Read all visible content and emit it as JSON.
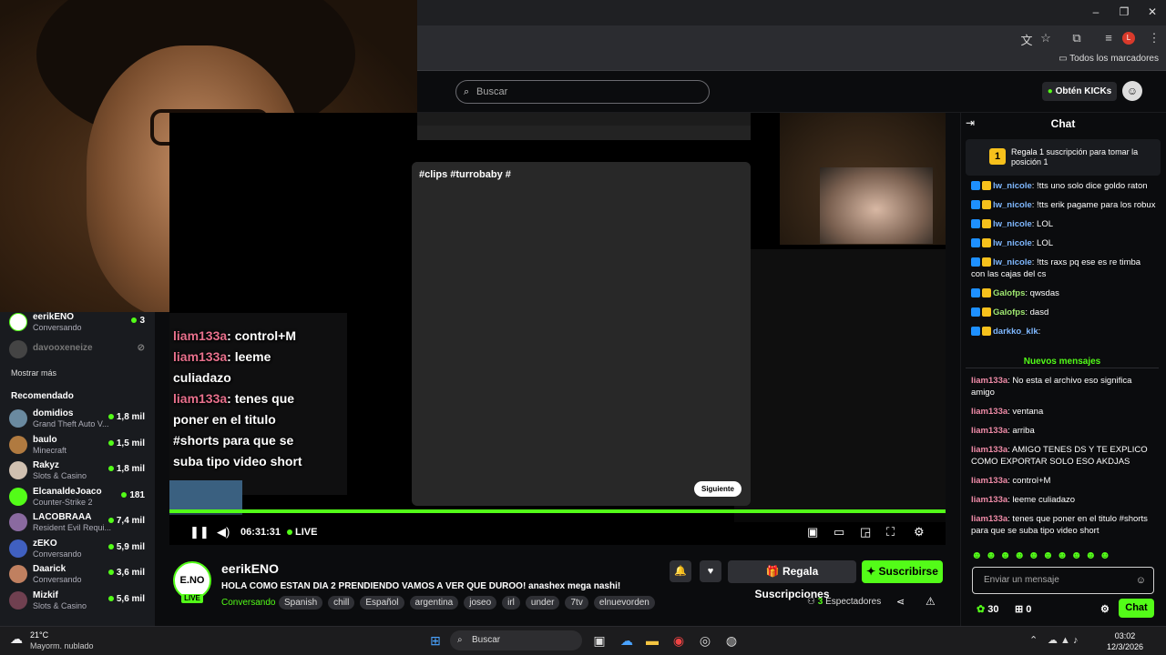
{
  "browser": {
    "bookmarks_label": "Todos los marcadores",
    "window_controls": [
      "minimize-icon",
      "maximize-icon",
      "close-icon"
    ],
    "toolbar_icons": [
      "translate-icon",
      "star-icon",
      "extensions-icon",
      "media-icon",
      "profile-icon",
      "menu-icon"
    ],
    "profile_initial": "L"
  },
  "kick_nav": {
    "search_placeholder": "Buscar",
    "get_kicks": "Obtén KICKs"
  },
  "sidebar": {
    "current": {
      "name": "eerikENO",
      "sub": "Conversando",
      "viewers": "3"
    },
    "offline": {
      "name": "davooxeneize"
    },
    "show_more": "Mostrar más",
    "recommended_title": "Recomendado",
    "recommended": [
      {
        "name": "domidios",
        "sub": "Grand Theft Auto V...",
        "viewers": "1,8 mil",
        "color": "#6a8aa0"
      },
      {
        "name": "baulo",
        "sub": "Minecraft",
        "viewers": "1,5 mil",
        "color": "#b07a40"
      },
      {
        "name": "Rakyz",
        "sub": "Slots & Casino",
        "viewers": "1,8 mil",
        "color": "#d0c0b0"
      },
      {
        "name": "ElcanaldeJoaco",
        "sub": "Counter-Strike 2",
        "viewers": "181",
        "color": "#53fc18"
      },
      {
        "name": "LACOBRAAA",
        "sub": "Resident Evil Requi...",
        "viewers": "7,4 mil",
        "color": "#8a6aa0"
      },
      {
        "name": "zEKO",
        "sub": "Conversando",
        "viewers": "5,9 mil",
        "color": "#4060c0"
      },
      {
        "name": "Daarick",
        "sub": "Conversando",
        "viewers": "3,6 mil",
        "color": "#c08060"
      },
      {
        "name": "Mizkif",
        "sub": "Slots & Casino",
        "viewers": "5,6 mil",
        "color": "#704050"
      }
    ]
  },
  "video": {
    "timecode": "06:31:31",
    "live_label": "LIVE",
    "overlay_chat": [
      {
        "user": "liam133a",
        "text": ": control+M"
      },
      {
        "user": "liam133a",
        "text": ": leeme culiadazo"
      },
      {
        "user": "liam133a",
        "text": ": tenes que poner en el titulo #shorts para que se suba tipo video short"
      }
    ],
    "modal_title": "#clips #turrobaby #",
    "modal_next": "Siguiente"
  },
  "stream": {
    "channel": "eerikENO",
    "logo_text": "E.NO",
    "live_badge": "LIVE",
    "title": "HOLA COMO ESTAN DIA 2 PRENDIENDO VAMOS A VER QUE DUROO! anashex mega nashi!",
    "category": "Conversando",
    "tags": [
      "Spanish",
      "chill",
      "Español",
      "argentina",
      "joseo",
      "irl",
      "under",
      "7tv",
      "elnuevorden"
    ],
    "gift_label": "Regala Suscripciones",
    "subscribe_label": "Suscribirse",
    "viewers_count": "3",
    "viewers_label": "Espectadores"
  },
  "chat": {
    "title": "Chat",
    "gift_rank": "1",
    "gift_banner": "Regala 1 suscripción para tomar la posición 1",
    "messages_before": [
      {
        "user": "lw_nicole",
        "text": ": !tts uno solo dice goldo raton",
        "color": "#7fb8ff"
      },
      {
        "user": "lw_nicole",
        "text": ": !tts erik pagame para los robux",
        "color": "#7fb8ff"
      },
      {
        "user": "lw_nicole",
        "text": ": LOL",
        "color": "#7fb8ff"
      },
      {
        "user": "lw_nicole",
        "text": ": LOL",
        "color": "#7fb8ff"
      },
      {
        "user": "lw_nicole",
        "text": ": !tts raxs pq ese es re timba con las cajas del cs",
        "color": "#7fb8ff"
      },
      {
        "user": "Galofps",
        "text": ": qwsdas",
        "color": "#9fe870"
      },
      {
        "user": "Galofps",
        "text": ": dasd",
        "color": "#9fe870"
      },
      {
        "user": "darkko_klk",
        "text": ":",
        "color": "#7fb8ff"
      }
    ],
    "new_messages_label": "Nuevos mensajes",
    "messages_after": [
      {
        "user": "liam133a",
        "text": ": No esta el archivo eso significa amigo",
        "color": "#f08ca8"
      },
      {
        "user": "liam133a",
        "text": ": ventana",
        "color": "#f08ca8"
      },
      {
        "user": "liam133a",
        "text": ": arriba",
        "color": "#f08ca8"
      },
      {
        "user": "liam133a",
        "text": ": AMIGO TENES DS Y TE EXPLICO COMO EXPORTAR SOLO ESO AKDJAS",
        "color": "#f08ca8"
      },
      {
        "user": "liam133a",
        "text": ": control+M",
        "color": "#f08ca8"
      },
      {
        "user": "liam133a",
        "text": ": leeme culiadazo",
        "color": "#f08ca8"
      },
      {
        "user": "liam133a",
        "text": ": tenes que poner en el titulo #shorts para que se suba tipo video short",
        "color": "#f08ca8"
      }
    ],
    "input_placeholder": "Enviar un mensaje",
    "points": "30",
    "gifts": "0",
    "send_label": "Chat"
  },
  "taskbar": {
    "temperature": "21°C",
    "weather": "Mayorm. nublado",
    "search": "Buscar",
    "time": "03:02",
    "date": "12/3/2026"
  },
  "colors": {
    "accent": "#53fc18",
    "background": "#0b0c0e",
    "panel": "#191b1f"
  }
}
